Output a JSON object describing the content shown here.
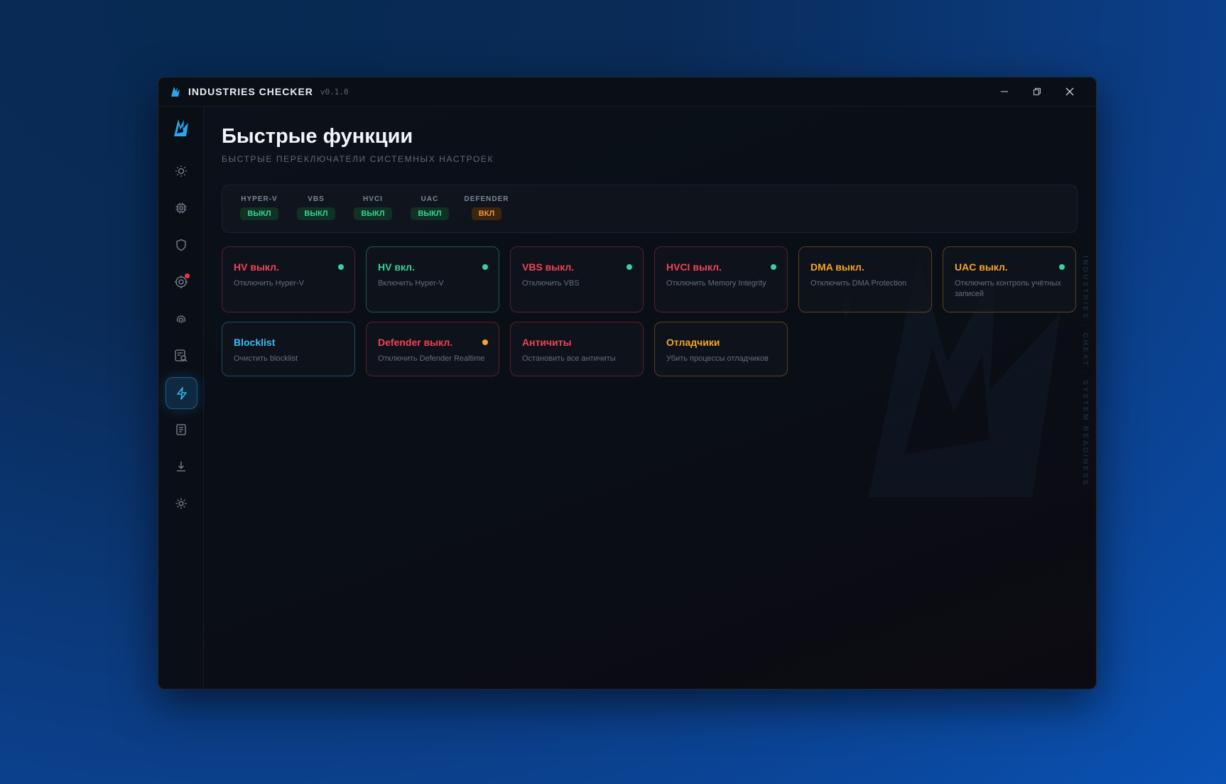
{
  "titlebar": {
    "title": "INDUSTRIES CHECKER",
    "version": "v0.1.0",
    "logo_icon": "flame-logo-icon",
    "controls": [
      "minimize-icon",
      "restore-icon",
      "close-icon"
    ]
  },
  "sidebar": {
    "items": [
      {
        "icon": "sun-icon",
        "active": false
      },
      {
        "icon": "chip-icon",
        "active": false
      },
      {
        "icon": "shield-icon",
        "active": false
      },
      {
        "icon": "target-icon",
        "active": false,
        "notification": true
      },
      {
        "icon": "fingerprint-icon",
        "active": false
      },
      {
        "icon": "search-doc-icon",
        "active": false
      },
      {
        "icon": "lightning-icon",
        "active": true
      },
      {
        "icon": "document-icon",
        "active": false
      },
      {
        "icon": "download-icon",
        "active": false
      },
      {
        "icon": "settings-icon",
        "active": false
      }
    ]
  },
  "page": {
    "title": "Быстрые функции",
    "subtitle": "БЫСТРЫЕ ПЕРЕКЛЮЧАТЕЛИ СИСТЕМНЫХ НАСТРОЕК"
  },
  "status": [
    {
      "label": "HYPER-V",
      "value": "ВЫКЛ",
      "state": "off"
    },
    {
      "label": "VBS",
      "value": "ВЫКЛ",
      "state": "off"
    },
    {
      "label": "HVCI",
      "value": "ВЫКЛ",
      "state": "off"
    },
    {
      "label": "UAC",
      "value": "ВЫКЛ",
      "state": "off"
    },
    {
      "label": "DEFENDER",
      "value": "ВКЛ",
      "state": "on"
    }
  ],
  "cards": [
    {
      "title": "HV выкл.",
      "desc": "Отключить Hyper-V",
      "color": "red",
      "dot": "green"
    },
    {
      "title": "HV вкл.",
      "desc": "Включить Hyper-V",
      "color": "green",
      "dot": "green"
    },
    {
      "title": "VBS выкл.",
      "desc": "Отключить VBS",
      "color": "red",
      "dot": "green"
    },
    {
      "title": "HVCI выкл.",
      "desc": "Отключить Memory Integrity",
      "color": "red",
      "dot": "green"
    },
    {
      "title": "DMA выкл.",
      "desc": "Отключить DMA Protection",
      "color": "orange",
      "dot": ""
    },
    {
      "title": "UAC выкл.",
      "desc": "Отключить контроль учётных записей",
      "color": "orange",
      "dot": "green"
    },
    {
      "title": "Blocklist",
      "desc": "Очистить blocklist",
      "color": "blue",
      "dot": ""
    },
    {
      "title": "Defender выкл.",
      "desc": "Отключить Defender Realtime",
      "color": "red",
      "dot": "orange"
    },
    {
      "title": "Античиты",
      "desc": "Остановить все античиты",
      "color": "red",
      "dot": ""
    },
    {
      "title": "Отладчики",
      "desc": "Убить процессы отладчиков",
      "color": "orange",
      "dot": ""
    }
  ],
  "colors": {
    "accent": "#38bdf8",
    "red": "#ef4458",
    "green": "#34d399",
    "orange": "#f5a524"
  }
}
